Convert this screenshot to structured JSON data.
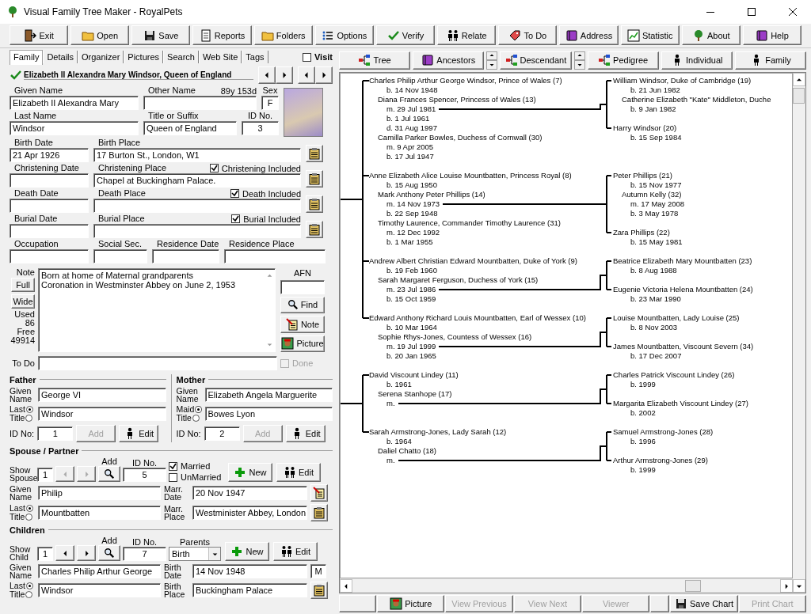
{
  "window": {
    "title": "Visual Family Tree Maker - RoyalPets"
  },
  "toolbar": [
    {
      "label": "Exit"
    },
    {
      "label": "Open"
    },
    {
      "label": "Save"
    },
    {
      "label": "Reports"
    },
    {
      "label": "Folders"
    },
    {
      "label": "Options"
    },
    {
      "label": "Verify"
    },
    {
      "label": "Relate"
    },
    {
      "label": "To Do"
    },
    {
      "label": "Address"
    },
    {
      "label": "Statistic"
    },
    {
      "label": "About"
    },
    {
      "label": "Help"
    }
  ],
  "tabs": [
    {
      "label": "Family",
      "selected": true
    },
    {
      "label": "Details",
      "selected": false
    },
    {
      "label": "Organizer",
      "selected": false
    },
    {
      "label": "Pictures",
      "selected": false
    },
    {
      "label": "Search",
      "selected": false
    },
    {
      "label": "Web Site",
      "selected": false
    },
    {
      "label": "Tags",
      "selected": false
    }
  ],
  "visit": {
    "label": "Visit",
    "checked": false
  },
  "person": {
    "name": "Elizabeth II Alexandra Mary Windsor, Queen of England",
    "given_name": {
      "label": "Given Name",
      "value": "Elizabeth II Alexandra Mary"
    },
    "other_name": {
      "label": "Other Name"
    },
    "age": "89y 153d",
    "sex": {
      "label": "Sex",
      "value": "F"
    },
    "last_name": {
      "label": "Last Name",
      "value": "Windsor"
    },
    "title": {
      "label": "Title or Suffix",
      "value": "Queen of England"
    },
    "id": {
      "label": "ID No.",
      "value": "3"
    },
    "events": [
      {
        "date_label": "Birth Date",
        "date": "21 Apr 1926",
        "place_label": "Birth Place",
        "place": "17 Burton St., London, W1"
      },
      {
        "date_label": "Christening Date",
        "place_label": "Christening Place",
        "place": "Chapel at Buckingham Palace.",
        "included": {
          "label": "Christening Included",
          "checked": true
        }
      },
      {
        "date_label": "Death Date",
        "place_label": "Death Place",
        "included": {
          "label": "Death Included",
          "checked": true
        }
      },
      {
        "date_label": "Burial Date",
        "place_label": "Burial Place",
        "included": {
          "label": "Burial Included",
          "checked": true
        }
      }
    ],
    "other": [
      {
        "label": "Occupation"
      },
      {
        "label": "Social Sec."
      },
      {
        "label": "Residence Date"
      },
      {
        "label": "Residence Place"
      }
    ]
  },
  "notes": {
    "label": "Note",
    "full": "Full",
    "wide": "Wide",
    "used_label": "Used",
    "used": "86",
    "free_label": "Free",
    "free": "49914",
    "text": "Born at home of Maternal grandparents\nCoronation in Westminster Abbey on June 2, 1953",
    "afn_label": "AFN",
    "find": "Find",
    "note": "Note",
    "picture": "Picture",
    "todo_label": "To Do",
    "done": {
      "label": "Done",
      "checked": false,
      "disabled": true
    }
  },
  "father": {
    "title": "Father",
    "given_label": "Given Name",
    "given": "George VI",
    "radios": [
      {
        "label": "Last",
        "selected": true
      },
      {
        "label": "Title",
        "selected": false
      }
    ],
    "last": "Windsor",
    "id_label": "ID No:",
    "id": "1",
    "add": {
      "label": "Add",
      "disabled": true
    },
    "edit": "Edit"
  },
  "mother": {
    "title": "Mother",
    "given_label": "Given Name",
    "given": "Elizabeth Angela Marguerite",
    "radios": [
      {
        "label": "Maid",
        "selected": true
      },
      {
        "label": "Title",
        "selected": false
      }
    ],
    "last": "Bowes Lyon",
    "id_label": "ID No:",
    "id": "2",
    "add": {
      "label": "Add",
      "disabled": true
    },
    "edit": "Edit"
  },
  "spouse": {
    "title": "Spouse / Partner",
    "show_label": "Show Spouse",
    "show": "1",
    "prev": {
      "disabled": true
    },
    "next": {
      "disabled": true
    },
    "add_label": "Add",
    "id_label": "ID No.",
    "id": "5",
    "married": {
      "label": "Married",
      "checked": true
    },
    "unmarried": {
      "label": "UnMarried",
      "checked": false
    },
    "new": "New",
    "edit": "Edit",
    "given_label": "Given Name",
    "given": "Philip",
    "radios": [
      {
        "label": "Last",
        "selected": true
      },
      {
        "label": "Title",
        "selected": false
      }
    ],
    "last": "Mountbatten",
    "date_label": "Marr. Date",
    "date": "20 Nov 1947",
    "place_label": "Marr. Place",
    "place": "Westminister Abbey, London"
  },
  "children": {
    "title": "Children",
    "show_label": "Show Child",
    "show": "1",
    "prev": {
      "disabled": false
    },
    "next": {
      "disabled": false
    },
    "add_label": "Add",
    "id_label": "ID No.",
    "id": "7",
    "parents_label": "Parents",
    "parents": "Birth",
    "new": "New",
    "edit": "Edit",
    "given_label": "Given Name",
    "given": "Charles Philip Arthur George",
    "radios": [
      {
        "label": "Last",
        "selected": true
      },
      {
        "label": "Title",
        "selected": false
      }
    ],
    "last": "Windsor",
    "date_label": "Birth Date",
    "date": "14 Nov 1948",
    "sex": "M",
    "place_label": "Birth Place",
    "place": "Buckingham Palace"
  },
  "views": [
    {
      "label": "Tree",
      "spinner": false
    },
    {
      "label": "Ancestors",
      "spinner": true
    },
    {
      "label": "Descendant",
      "spinner": true
    },
    {
      "label": "Pedigree",
      "spinner": false
    },
    {
      "label": "Individual",
      "spinner": false
    },
    {
      "label": "Family",
      "spinner": false
    }
  ],
  "tree": {
    "branches": [
      {
        "families": [
          {
            "parent": [
              {
                "kind": "name",
                "text": "Charles Philip Arthur George Windsor, Prince of Wales (7)"
              },
              {
                "kind": "event",
                "text": "b. 14 Nov 1948"
              },
              {
                "kind": "spouse",
                "text": "Diana Frances Spencer, Princess of Wales (13)"
              },
              {
                "kind": "event",
                "text": "m. 29 Jul 1981",
                "link": true
              },
              {
                "kind": "event",
                "text": "b. 1 Jul 1961"
              },
              {
                "kind": "event",
                "text": "d. 31 Aug 1997"
              },
              {
                "kind": "spouse",
                "text": "Camilla Parker Bowles, Duchess of Cornwall (30)"
              },
              {
                "kind": "event",
                "text": "m. 9 Apr 2005"
              },
              {
                "kind": "event",
                "text": "b. 17 Jul 1947"
              }
            ],
            "children": [
              {
                "lines": [
                  {
                    "kind": "name",
                    "text": "William Windsor, Duke of Cambridge (19)"
                  },
                  {
                    "kind": "event",
                    "text": "b. 21 Jun 1982"
                  },
                  {
                    "kind": "spouse",
                    "text": "Catherine Elizabeth \"Kate\" Middleton, Duche"
                  },
                  {
                    "kind": "event",
                    "text": "b. 9 Jan 1982"
                  }
                ]
              },
              {
                "lines": [
                  {
                    "kind": "name",
                    "text": "Harry Windsor (20)"
                  },
                  {
                    "kind": "event",
                    "text": "b. 15 Sep 1984"
                  }
                ]
              }
            ]
          },
          {
            "parent": [
              {
                "kind": "name",
                "text": "Anne Elizabeth Alice Louise Mountbatten, Princess Royal (8)"
              },
              {
                "kind": "event",
                "text": "b. 15 Aug 1950"
              },
              {
                "kind": "spouse",
                "text": "Mark Anthony Peter Phillips (14)"
              },
              {
                "kind": "event",
                "text": "m. 14 Nov 1973",
                "link": true
              },
              {
                "kind": "event",
                "text": "b. 22 Sep 1948"
              },
              {
                "kind": "spouse",
                "text": "Timothy Laurence, Commander Timothy Laurence (31)"
              },
              {
                "kind": "event",
                "text": "m. 12 Dec 1992"
              },
              {
                "kind": "event",
                "text": "b. 1 Mar 1955"
              }
            ],
            "children": [
              {
                "lines": [
                  {
                    "kind": "name",
                    "text": "Peter Phillips (21)"
                  },
                  {
                    "kind": "event",
                    "text": "b. 15 Nov 1977"
                  },
                  {
                    "kind": "spouse",
                    "text": "Autumn Kelly (32)"
                  },
                  {
                    "kind": "event",
                    "text": "m. 17 May 2008"
                  },
                  {
                    "kind": "event",
                    "text": "b. 3 May 1978"
                  }
                ]
              },
              {
                "lines": [
                  {
                    "kind": "name",
                    "text": "Zara Phillips (22)"
                  },
                  {
                    "kind": "event",
                    "text": "b. 15 May 1981"
                  }
                ]
              }
            ]
          },
          {
            "parent": [
              {
                "kind": "name",
                "text": "Andrew Albert Christian Edward Mountbatten, Duke of York (9)"
              },
              {
                "kind": "event",
                "text": "b. 19 Feb 1960"
              },
              {
                "kind": "spouse",
                "text": "Sarah Margaret Ferguson, Duchess of York (15)"
              },
              {
                "kind": "event",
                "text": "m. 23 Jul 1986",
                "link": true
              },
              {
                "kind": "event",
                "text": "b. 15 Oct 1959"
              }
            ],
            "children": [
              {
                "lines": [
                  {
                    "kind": "name",
                    "text": "Beatrice Elizabeth Mary Mountbatten (23)"
                  },
                  {
                    "kind": "event",
                    "text": "b. 8 Aug 1988"
                  }
                ]
              },
              {
                "lines": [
                  {
                    "kind": "name",
                    "text": "Eugenie Victoria Helena Mountbatten (24)"
                  },
                  {
                    "kind": "event",
                    "text": "b. 23 Mar 1990"
                  }
                ]
              }
            ]
          },
          {
            "parent": [
              {
                "kind": "name",
                "text": "Edward Anthony Richard Louis Mountbatten, Earl of Wessex (10)"
              },
              {
                "kind": "event",
                "text": "b. 10 Mar 1964"
              },
              {
                "kind": "spouse",
                "text": "Sophie Rhys-Jones, Countess of Wessex (16)"
              },
              {
                "kind": "event",
                "text": "m. 19 Jul 1999",
                "link": true
              },
              {
                "kind": "event",
                "text": "b. 20 Jan 1965"
              }
            ],
            "children": [
              {
                "lines": [
                  {
                    "kind": "name",
                    "text": "Louise Mountbatten, Lady Louise (25)"
                  },
                  {
                    "kind": "event",
                    "text": "b. 8 Nov 2003"
                  }
                ]
              },
              {
                "lines": [
                  {
                    "kind": "name",
                    "text": "James Mountbatten, Viscount Severn (34)"
                  },
                  {
                    "kind": "event",
                    "text": "b. 17 Dec 2007"
                  }
                ]
              }
            ]
          }
        ]
      },
      {
        "families": [
          {
            "parent": [
              {
                "kind": "name",
                "text": "David Viscount Lindey (11)"
              },
              {
                "kind": "event",
                "text": "b. 1961"
              },
              {
                "kind": "spouse",
                "text": "Serena Stanhope (17)"
              },
              {
                "kind": "event",
                "text": "m.",
                "link": true
              }
            ],
            "children": [
              {
                "lines": [
                  {
                    "kind": "name",
                    "text": "Charles Patrick Viscount Lindey (26)"
                  },
                  {
                    "kind": "event",
                    "text": "b. 1999"
                  }
                ]
              },
              {
                "lines": [
                  {
                    "kind": "name",
                    "text": "Margarita Elizabeth Viscount Lindey (27)"
                  },
                  {
                    "kind": "event",
                    "text": "b. 2002"
                  }
                ]
              }
            ]
          },
          {
            "parent": [
              {
                "kind": "name",
                "text": "Sarah Armstrong-Jones, Lady Sarah (12)"
              },
              {
                "kind": "event",
                "text": "b. 1964"
              },
              {
                "kind": "spouse",
                "text": "Daliel Chatto (18)"
              },
              {
                "kind": "event",
                "text": "m.",
                "link": true
              }
            ],
            "children": [
              {
                "lines": [
                  {
                    "kind": "name",
                    "text": "Samuel Armstrong-Jones (28)"
                  },
                  {
                    "kind": "event",
                    "text": "b. 1996"
                  }
                ]
              },
              {
                "lines": [
                  {
                    "kind": "name",
                    "text": "Arthur Armstrong-Jones (29)"
                  },
                  {
                    "kind": "event",
                    "text": "b. 1999"
                  }
                ]
              }
            ]
          }
        ]
      }
    ]
  },
  "bottom_buttons": [
    {
      "kind": "picture",
      "label": "Picture",
      "disabled": false
    },
    {
      "kind": "plain",
      "label": "View Previous",
      "disabled": true
    },
    {
      "kind": "plain",
      "label": "View Next",
      "disabled": true
    },
    {
      "kind": "plain",
      "label": "Viewer",
      "disabled": true
    },
    {
      "kind": "blank"
    },
    {
      "kind": "save",
      "label": "Save Chart",
      "disabled": false
    },
    {
      "kind": "plain",
      "label": "Print Chart",
      "disabled": true
    }
  ]
}
